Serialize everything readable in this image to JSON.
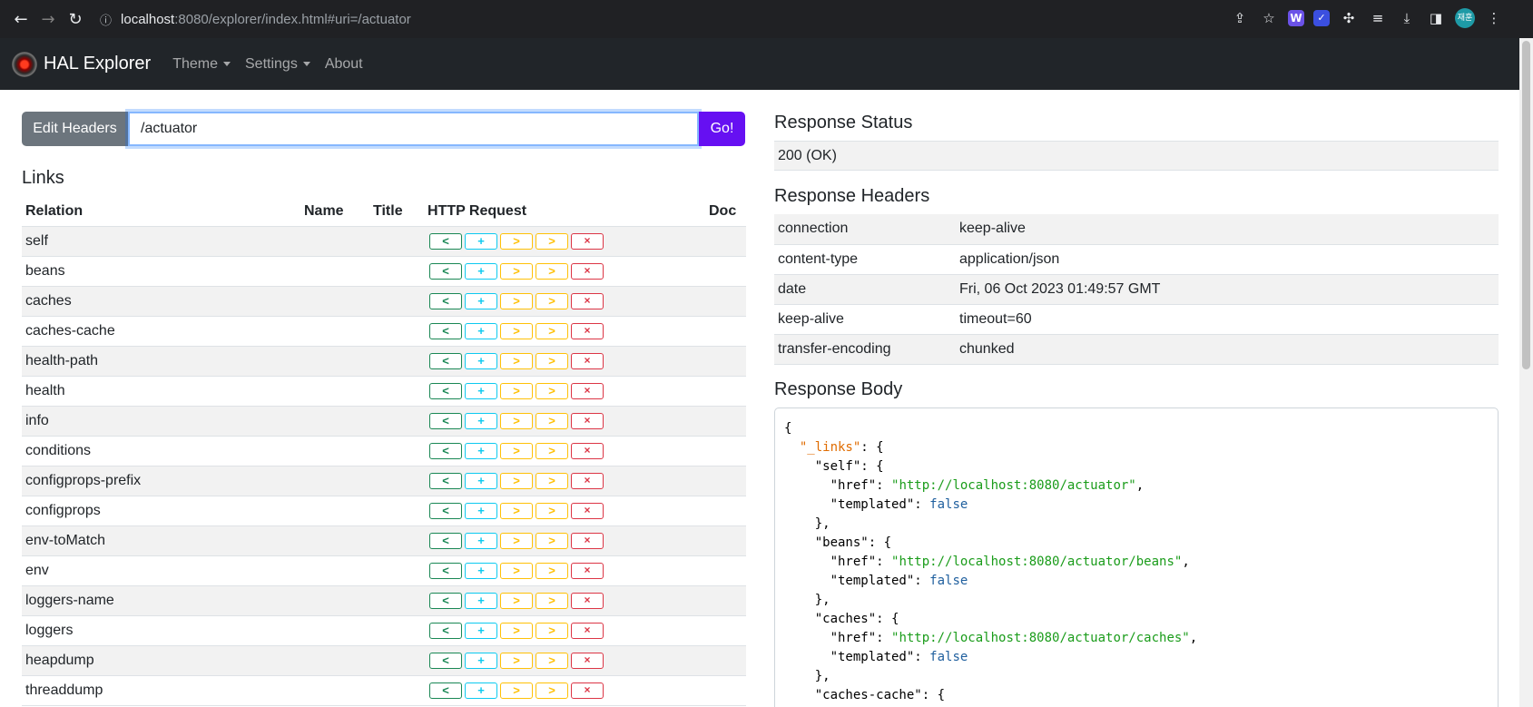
{
  "browser": {
    "url_host": "localhost",
    "url_rest": ":8080/explorer/index.html#uri=/actuator",
    "profile_label": "재훈"
  },
  "navbar": {
    "brand": "HAL Explorer",
    "items": [
      {
        "label": "Theme",
        "dropdown": true
      },
      {
        "label": "Settings",
        "dropdown": true
      },
      {
        "label": "About",
        "dropdown": false
      }
    ]
  },
  "request": {
    "edit_headers_label": "Edit Headers",
    "uri_value": "/actuator",
    "go_label": "Go!"
  },
  "links": {
    "title": "Links",
    "columns": [
      "Relation",
      "Name",
      "Title",
      "HTTP Request",
      "Doc"
    ],
    "button_glyphs": [
      "<",
      "+",
      ">",
      ">",
      "×"
    ],
    "rows": [
      "self",
      "beans",
      "caches",
      "caches-cache",
      "health-path",
      "health",
      "info",
      "conditions",
      "configprops-prefix",
      "configprops",
      "env-toMatch",
      "env",
      "loggers-name",
      "loggers",
      "heapdump",
      "threaddump"
    ]
  },
  "response_status": {
    "title": "Response Status",
    "value": "200 (OK)"
  },
  "response_headers": {
    "title": "Response Headers",
    "rows": [
      {
        "name": "connection",
        "value": "keep-alive"
      },
      {
        "name": "content-type",
        "value": "application/json"
      },
      {
        "name": "date",
        "value": "Fri, 06 Oct 2023 01:49:57 GMT"
      },
      {
        "name": "keep-alive",
        "value": "timeout=60"
      },
      {
        "name": "transfer-encoding",
        "value": "chunked"
      }
    ]
  },
  "response_body": {
    "title": "Response Body",
    "top_key": "\"_links\"",
    "entries": [
      {
        "key": "\"self\"",
        "href": "\"http://localhost:8080/actuator\"",
        "templated": "false"
      },
      {
        "key": "\"beans\"",
        "href": "\"http://localhost:8080/actuator/beans\"",
        "templated": "false"
      },
      {
        "key": "\"caches\"",
        "href": "\"http://localhost:8080/actuator/caches\"",
        "templated": "false"
      }
    ],
    "last_key": "\"caches-cache\""
  },
  "colors": {
    "primary_go": "#6610f2",
    "secondary": "#6c757d",
    "json_string": "#1a9c1a",
    "json_boolean": "#1f5f9e",
    "json_top_key": "#e06c00"
  }
}
